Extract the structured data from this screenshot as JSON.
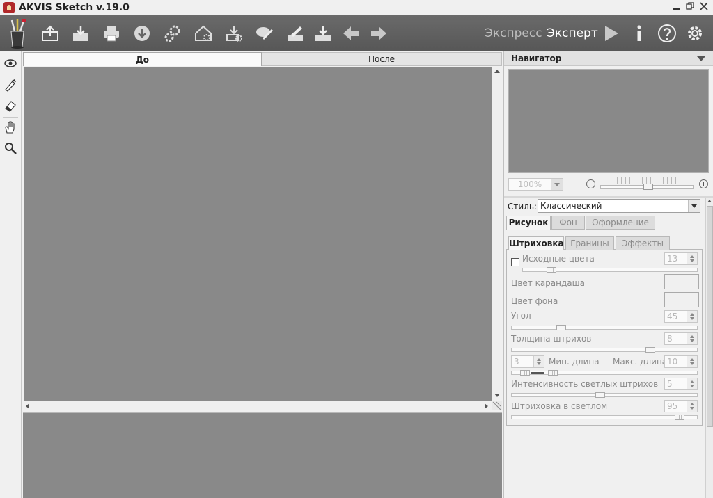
{
  "app": {
    "title": "AKVIS Sketch v.19.0"
  },
  "toolbar": {
    "mode_express": "Экспресс",
    "mode_expert": "Эксперт"
  },
  "image_tabs": {
    "before": "До",
    "after": "После"
  },
  "navigator": {
    "title": "Навигатор",
    "zoom_value": "100%"
  },
  "settings": {
    "style_label": "Стиль:",
    "style_value": "Классический",
    "main_tabs": [
      "Рисунок",
      "Фон",
      "Оформление"
    ],
    "sub_tabs": [
      "Штриховка",
      "Границы",
      "Эффекты"
    ],
    "source_colors": {
      "label": "Исходные цвета",
      "value": "13"
    },
    "pencil_color": "Цвет карандаша",
    "bg_color": "Цвет фона",
    "angle": {
      "label": "Угол",
      "value": "45"
    },
    "stroke_thickness": {
      "label": "Толщина штрихов",
      "value": "8"
    },
    "min_length": {
      "label": "Мин. длина",
      "value": "3"
    },
    "max_length": {
      "label": "Макс. длина",
      "value": "10"
    },
    "light_intensity": {
      "label": "Интенсивность светлых штрихов",
      "value": "5"
    },
    "light_hatching": {
      "label": "Штриховка в светлом",
      "value": "95"
    }
  }
}
